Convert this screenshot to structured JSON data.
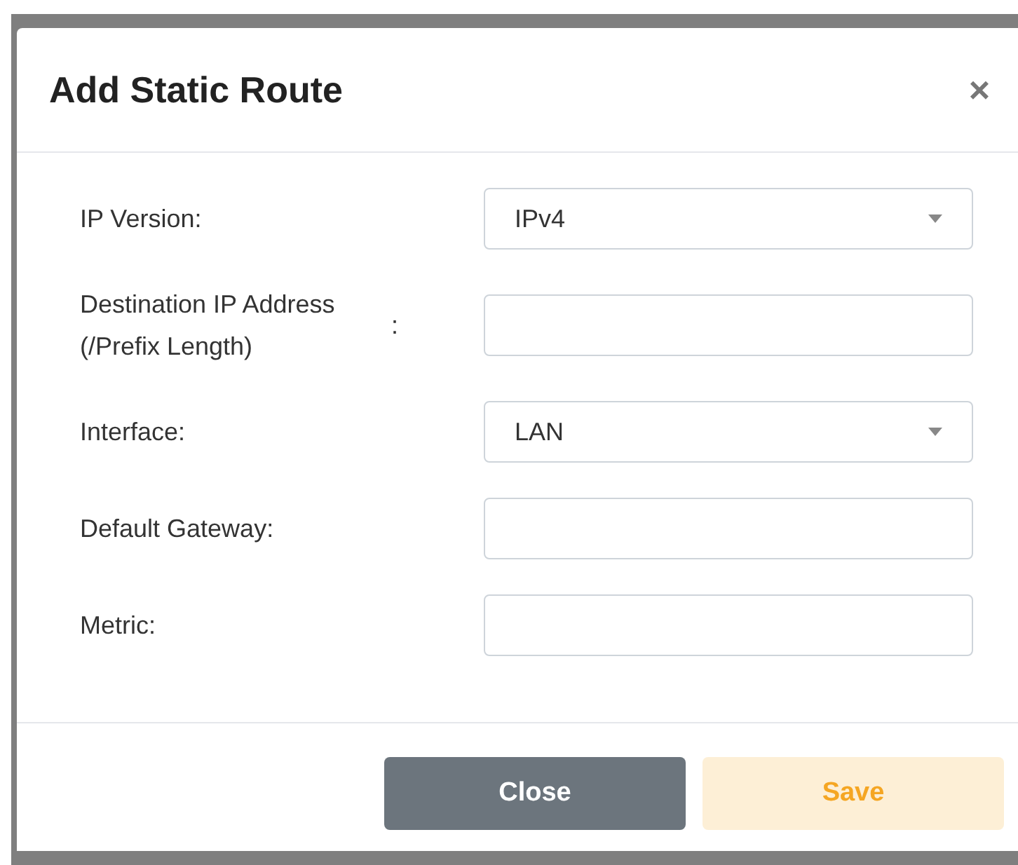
{
  "dialog": {
    "title": "Add Static Route",
    "close_icon": "×"
  },
  "fields": [
    {
      "kind": "select",
      "label": "IP Version:",
      "value": "IPv4"
    },
    {
      "kind": "text",
      "label": "Destination IP Address (/Prefix Length)",
      "colon": ":"
    },
    {
      "kind": "select",
      "label": "Interface:",
      "value": "LAN"
    },
    {
      "kind": "text",
      "label": "Default Gateway:"
    },
    {
      "kind": "text",
      "label": "Metric:"
    }
  ],
  "buttons": [
    {
      "label": "Close",
      "kind": "secondary",
      "disabled": false
    },
    {
      "label": "Save",
      "kind": "primary",
      "disabled": true
    }
  ]
}
